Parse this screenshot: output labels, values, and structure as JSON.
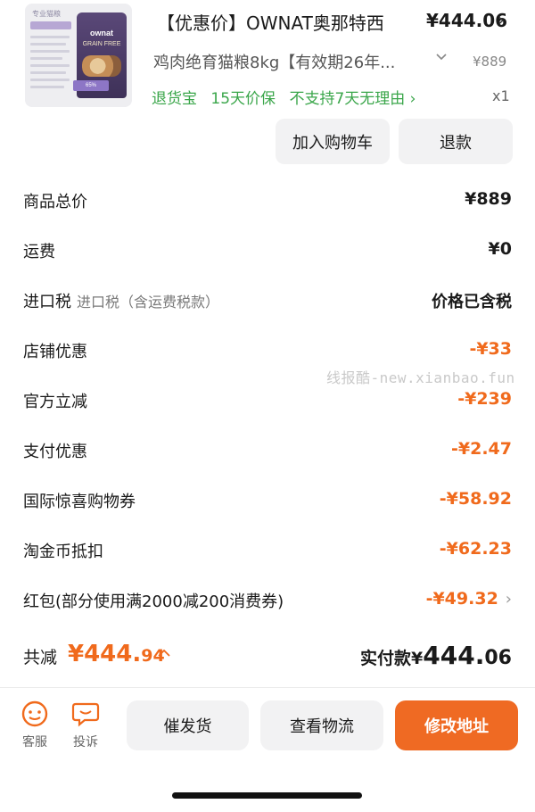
{
  "product": {
    "title": "【优惠价】OWNAT奥那特西",
    "price": "¥444.06",
    "spec": "鸡肉绝育猫粮8kg【有效期26年...",
    "original_price": "¥889",
    "quantity": "x1",
    "services": [
      "退货宝",
      "15天价保",
      "不支持7天无理由 ›"
    ],
    "image_text": {
      "brand": "ownat",
      "tag": "GRAIN FREE"
    }
  },
  "actions": {
    "add_to_cart": "加入购物车",
    "refund": "退款"
  },
  "fees": [
    {
      "label": "商品总价",
      "value": "¥889",
      "discount": false
    },
    {
      "label": "运费",
      "value": "¥0",
      "discount": false
    },
    {
      "label": "进口税",
      "sub": "进口税（含运费税款）",
      "value": "价格已含税",
      "discount": false
    },
    {
      "label": "店铺优惠",
      "value": "-¥33",
      "discount": true
    },
    {
      "label": "官方立减",
      "value": "-¥239",
      "discount": true
    },
    {
      "label": "支付优惠",
      "value": "-¥2.47",
      "discount": true
    },
    {
      "label": "国际惊喜购物券",
      "value": "-¥58.92",
      "discount": true
    },
    {
      "label": "淘金币抵扣",
      "value": "-¥62.23",
      "discount": true
    },
    {
      "label": "红包(部分使用满2000减200消费券)",
      "value": "-¥49.32",
      "discount": true,
      "chevron": "›"
    }
  ],
  "watermark": "线报酷-new.xianbao.fun",
  "summary": {
    "total_discount_label": "共减",
    "total_discount_main": "¥444.",
    "total_discount_dec": "94",
    "total_discount_chevron": "^",
    "paid_label": "实付款¥",
    "paid_main": "444.",
    "paid_dec": "06"
  },
  "bottom_bar": {
    "service_label": "客服",
    "complaint_label": "投诉",
    "urge": "催发货",
    "logistics": "查看物流",
    "change_address": "修改地址"
  },
  "colors": {
    "discount": "#f06a1c",
    "service_green": "#3aa64a",
    "primary_button": "#ef6a23"
  }
}
